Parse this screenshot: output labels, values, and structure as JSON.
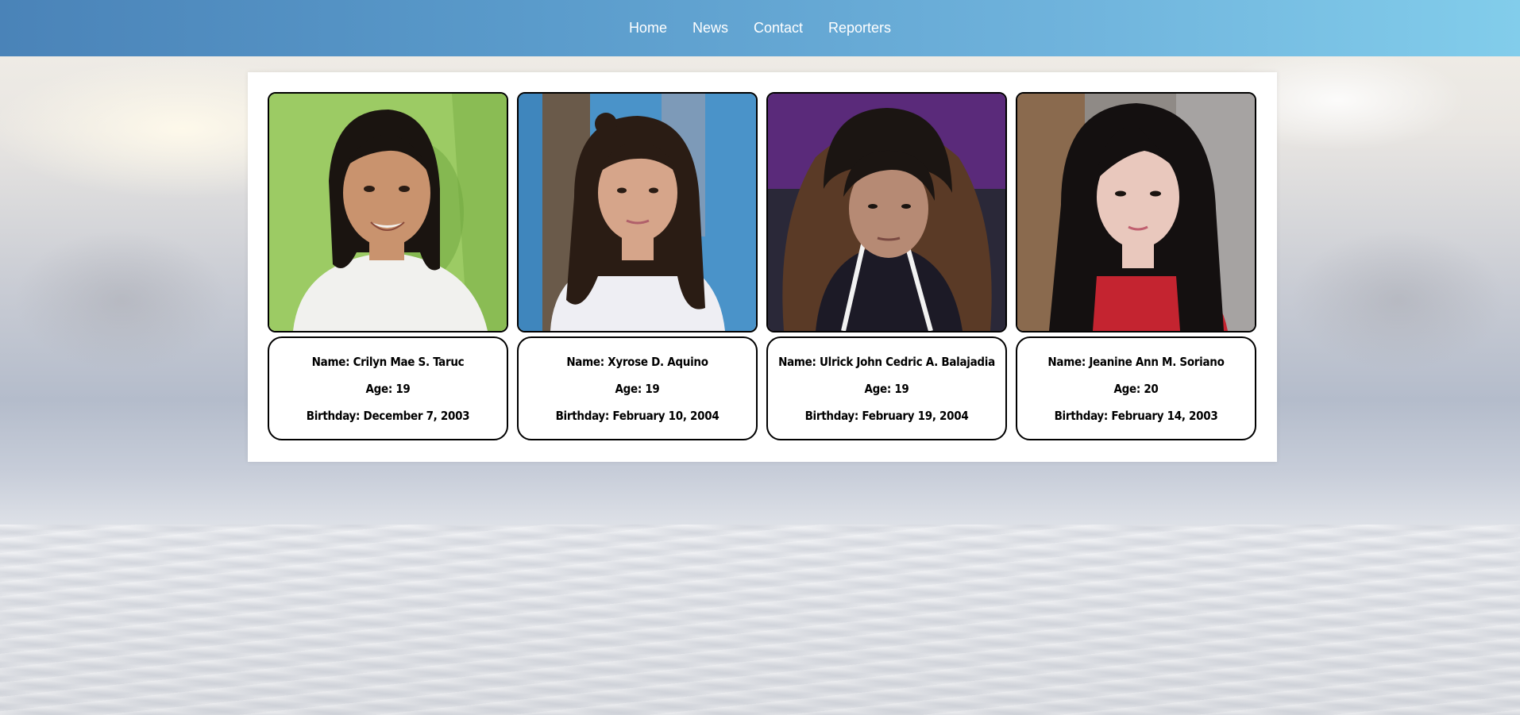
{
  "nav": {
    "items": [
      {
        "label": "Home"
      },
      {
        "label": "News"
      },
      {
        "label": "Contact"
      },
      {
        "label": "Reporters"
      }
    ]
  },
  "reporters": [
    {
      "name": "Name: Crilyn Mae S. Taruc",
      "age": "Age: 19",
      "birthday": "Birthday: December 7, 2003",
      "photo_bg": "#9ccb64",
      "hair": "#1a1410",
      "skin": "#c9936e",
      "clothes": "#f1f1ee"
    },
    {
      "name": "Name: Xyrose D. Aquino",
      "age": "Age: 19",
      "birthday": "Birthday: February 10, 2004",
      "photo_bg": "#4a93c9",
      "hair": "#2a1c14",
      "skin": "#d6a58a",
      "clothes": "#eeeef3"
    },
    {
      "name": "Name: Ulrick John Cedric A. Balajadia",
      "age": "Age: 19",
      "birthday": "Birthday: February 19, 2004",
      "photo_bg": "#5a2a7a",
      "hair": "#1b1512",
      "skin": "#b68a74",
      "clothes": "#5a3a26"
    },
    {
      "name": "Name: Jeanine Ann M. Soriano",
      "age": "Age: 20",
      "birthday": "Birthday: February 14, 2003",
      "photo_bg": "#8f8a86",
      "hair": "#141010",
      "skin": "#e9c8bd",
      "clothes": "#c42430"
    }
  ]
}
